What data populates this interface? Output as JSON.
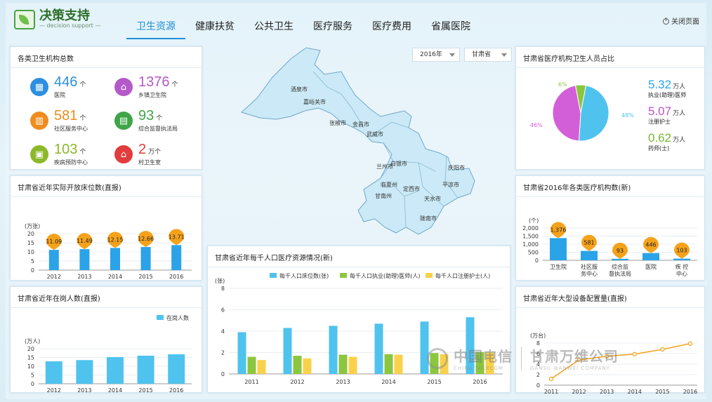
{
  "header": {
    "logo_title": "决策支持",
    "logo_sub": "— decision support —",
    "tabs": [
      "卫生资源",
      "健康扶贫",
      "公共卫生",
      "医疗服务",
      "医疗费用",
      "省属医院"
    ],
    "active_tab": 0,
    "close_label": "关闭页面"
  },
  "filters": {
    "year": "2016年",
    "region": "甘肃省"
  },
  "orgs": {
    "title": "各类卫生机构总数",
    "items": [
      {
        "value": "446",
        "unit": "个",
        "label": "医院",
        "color": "#2c8fe0",
        "icon": "building-icon"
      },
      {
        "value": "1376",
        "unit": "个",
        "label": "乡镇卫生院",
        "color": "#b45ac8",
        "icon": "clinic-icon"
      },
      {
        "value": "581",
        "unit": "个",
        "label": "社区服务中心",
        "color": "#f08c1e",
        "icon": "community-icon"
      },
      {
        "value": "93",
        "unit": "个",
        "label": "综合监督执法局",
        "color": "#3fa548",
        "icon": "office-icon"
      },
      {
        "value": "103",
        "unit": "个",
        "label": "疾病预防中心",
        "color": "#8cb82a",
        "icon": "cdc-icon"
      },
      {
        "value": "2",
        "unit": "万个",
        "label": "村卫生室",
        "color": "#e23c3c",
        "icon": "house-icon"
      }
    ]
  },
  "beds": {
    "title": "甘肃省近年实际开放床位数(直报)",
    "unit": "(万张)"
  },
  "staff": {
    "title": "甘肃省近年在岗人数(直报)",
    "unit": "(万人)",
    "legend": "在岗人数"
  },
  "per_thousand": {
    "title": "甘肃省近年每千人口医疗资源情况(新)",
    "unit": "(张)",
    "legend": [
      "每千人口床位数(张)",
      "每千人口执业(助理)医师(人)",
      "每千人口注册护士(人)"
    ]
  },
  "ratio": {
    "title": "甘肃省医疗机构卫生人员占比",
    "items": [
      {
        "value": "5.32",
        "unit": "万人",
        "label": "执业(助理)医师",
        "color": "#2aa3e8"
      },
      {
        "value": "5.07",
        "unit": "万人",
        "label": "注册护士",
        "color": "#c04fd0"
      },
      {
        "value": "0.62",
        "unit": "万人",
        "label": "药师(士)",
        "color": "#7ab532"
      }
    ],
    "pie_labels": [
      "48%",
      "46%",
      "6%"
    ]
  },
  "inst2016": {
    "title": "甘肃省2016年各类医疗机构数(新)",
    "unit": "(个)"
  },
  "equip": {
    "title": "甘肃省近年大型设备配置量(直报)",
    "unit": "(万台)"
  },
  "map": {
    "cities": [
      "酒泉市",
      "嘉峪关市",
      "张掖市",
      "金昌市",
      "武威市",
      "白银市",
      "兰州市",
      "临夏州",
      "定西市",
      "甘南州",
      "天水市",
      "陇南市",
      "平凉市",
      "庆阳市"
    ]
  },
  "watermark": {
    "cn1": "中国电信",
    "en1": "CHINA TELECOM",
    "cn2": "甘肃万维公司",
    "en2": "GANSU WANWEI COMPANY"
  },
  "chart_data": [
    {
      "type": "bar",
      "title": "甘肃省近年实际开放床位数(直报)",
      "ylabel": "(万张)",
      "categories": [
        "2012",
        "2013",
        "2014",
        "2015",
        "2016"
      ],
      "values": [
        11.09,
        11.49,
        12.15,
        12.66,
        13.71
      ],
      "ylim": [
        0,
        20
      ],
      "yticks": [
        0,
        5,
        10,
        15,
        20
      ],
      "color": "#2aa3e8",
      "label_color": "#f5a21b"
    },
    {
      "type": "bar",
      "title": "甘肃省近年在岗人数(直报)",
      "ylabel": "(万人)",
      "categories": [
        "2012",
        "2013",
        "2014",
        "2015",
        "2016"
      ],
      "series": [
        {
          "name": "在岗人数",
          "values": [
            12.8,
            13.5,
            15.2,
            16.0,
            16.8
          ]
        }
      ],
      "ylim": [
        0,
        20
      ],
      "yticks": [
        0,
        5,
        10,
        15,
        20
      ],
      "color": "#4fc3ee"
    },
    {
      "type": "bar",
      "title": "甘肃省近年每千人口医疗资源情况(新)",
      "ylabel": "(张)",
      "categories": [
        "2011",
        "2012",
        "2013",
        "2014",
        "2015",
        "2016"
      ],
      "series": [
        {
          "name": "每千人口床位数(张)",
          "values": [
            3.9,
            4.3,
            4.5,
            4.7,
            4.9,
            5.3
          ],
          "color": "#4fc3ee"
        },
        {
          "name": "每千人口执业(助理)医师(人)",
          "values": [
            1.6,
            1.7,
            1.8,
            1.85,
            1.95,
            2.05
          ],
          "color": "#8cc63f"
        },
        {
          "name": "每千人口注册护士(人)",
          "values": [
            1.3,
            1.45,
            1.6,
            1.8,
            1.85,
            2.0
          ],
          "color": "#f9d14b"
        }
      ],
      "ylim": [
        0,
        8
      ],
      "yticks": [
        0,
        2,
        4,
        6,
        8
      ]
    },
    {
      "type": "pie",
      "title": "甘肃省医疗机构卫生人员占比",
      "slices": [
        {
          "name": "执业(助理)医师",
          "value": 48,
          "color": "#4fc3ee"
        },
        {
          "name": "注册护士",
          "value": 46,
          "color": "#d35fd8"
        },
        {
          "name": "药师(士)",
          "value": 6,
          "color": "#8cc63f"
        }
      ]
    },
    {
      "type": "bar",
      "title": "甘肃省2016年各类医疗机构数(新)",
      "ylabel": "(个)",
      "categories": [
        "卫生院",
        "社区服务中心",
        "综合监督执法局",
        "医院",
        "疾控中心"
      ],
      "category_lines": [
        [
          "卫生院"
        ],
        [
          "社区服",
          "务中心"
        ],
        [
          "综合监",
          "督执法局"
        ],
        [
          "医院"
        ],
        [
          "疾 控",
          "中心"
        ]
      ],
      "values": [
        1376,
        581,
        93,
        446,
        103
      ],
      "value_labels": [
        "1,376",
        "581",
        "93",
        "446",
        "103"
      ],
      "ylim": [
        0,
        2000
      ],
      "yticks": [
        "0",
        "500",
        "1,000",
        "1,500",
        "2,000"
      ],
      "color": "#2aa3e8",
      "label_color": "#f5a21b"
    },
    {
      "type": "line",
      "title": "甘肃省近年大型设备配置量(直报)",
      "ylabel": "(万台)",
      "x": [
        "2011",
        "2012",
        "2013",
        "2014",
        "2015",
        "2016"
      ],
      "values": [
        1.2,
        4.8,
        5.5,
        5.9,
        6.8,
        7.9
      ],
      "ylim": [
        0,
        8
      ],
      "yticks": [
        0,
        2,
        4,
        6,
        8
      ],
      "color": "#f5a21b"
    }
  ]
}
